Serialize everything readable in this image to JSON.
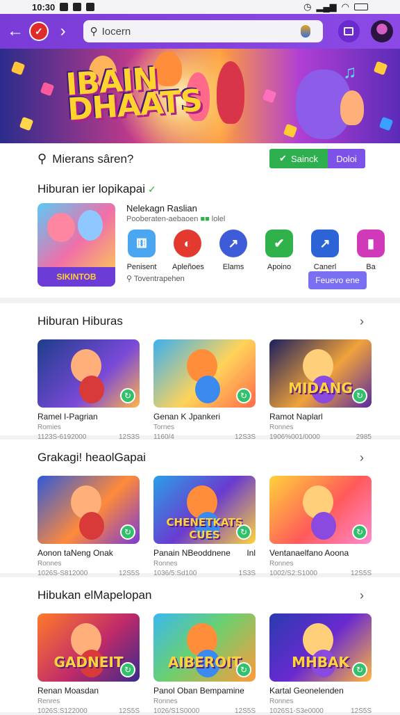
{
  "status_bar": {
    "time": "10:30"
  },
  "toolbar": {
    "search_value": "Iocern"
  },
  "hero": {
    "title": "IBAIN\nDHAATS"
  },
  "quick_search": {
    "label": "Mierans sâren?",
    "green_button": "Sainck",
    "purple_button": "Doloi"
  },
  "featured": {
    "title": "Hiburan ier lopikapai",
    "thumb_badge": "SIKINTOB",
    "name": "Nelekagn Raslian",
    "subtitle": "Pooberaten-aebaoen",
    "subtitle_tail": "lolel",
    "apps": [
      {
        "label": "Penisent",
        "icon": "dice-icon",
        "color": "#4aa6f0"
      },
      {
        "label": "Apleñoes",
        "icon": "red-ring-icon",
        "color": "#e23a2f"
      },
      {
        "label": "Elams",
        "icon": "trend-arrow-icon",
        "color": "#3e5bd8"
      },
      {
        "label": "Apoino",
        "icon": "green-check-icon",
        "color": "#2fb24a"
      },
      {
        "label": "Canerl",
        "icon": "blue-chart-icon",
        "color": "#2c64d8"
      },
      {
        "label": "Ba",
        "icon": "pink-app-icon",
        "color": "#d03ab8"
      }
    ],
    "link_text": "Toventrapehen",
    "action_button": "Feuevo ene"
  },
  "sections": [
    {
      "title": "Hiburan Hiburas",
      "cards": [
        {
          "title": "Ramel I-Pagrian",
          "title_tail": "",
          "sub": "Romies",
          "meta_left": "1123S-6192000",
          "meta_right": "12S3S",
          "art_text": ""
        },
        {
          "title": "Genan K Jpankeri",
          "title_tail": "",
          "sub": "Tornes",
          "meta_left": "1160/4",
          "meta_right": "12S3S",
          "art_text": ""
        },
        {
          "title": "Ramot Naplarl",
          "title_tail": "",
          "sub": "Ronnes",
          "meta_left": "1906%001/0000",
          "meta_right": "2985",
          "art_text": "MIDANG"
        }
      ]
    },
    {
      "title": "Grakagi! heaolGapai",
      "cards": [
        {
          "title": "Aonon taNeng Onak",
          "title_tail": "",
          "sub": "Ronnes",
          "meta_left": "1026S-S812000",
          "meta_right": "12S5S",
          "art_text": ""
        },
        {
          "title": "Panain NBeoddnene",
          "title_tail": "Inl",
          "sub": "Ronnes",
          "meta_left": "1036/5:Sd100",
          "meta_right": "1S3S",
          "art_text": "CHENETKATS CUES"
        },
        {
          "title": "Ventanaelfano Aoona",
          "title_tail": "",
          "sub": "Ronnes",
          "meta_left": "1002/S2:S1000",
          "meta_right": "12S5S",
          "art_text": ""
        }
      ]
    },
    {
      "title": "Hibukan elMapelopan",
      "cards": [
        {
          "title": "Renan Moasdan",
          "title_tail": "",
          "sub": "Renres",
          "meta_left": "1026S:S122000",
          "meta_right": "12S5S",
          "art_text": "GADNEIT"
        },
        {
          "title": "Panol Oban Bempamine",
          "title_tail": "",
          "sub": "Ronnes",
          "meta_left": "1026/S1S0000",
          "meta_right": "12S5S",
          "art_text": "AIBEROIT"
        },
        {
          "title": "Kartal Geonelenden",
          "title_tail": "",
          "sub": "Ronnes",
          "meta_left": "1026S1-S3e0000",
          "meta_right": "12S5S",
          "art_text": "MHBAK"
        }
      ]
    }
  ],
  "colors": {
    "topbar": "#7a3bd6",
    "accent_green": "#2eb04e",
    "accent_purple": "#7c52e8"
  }
}
